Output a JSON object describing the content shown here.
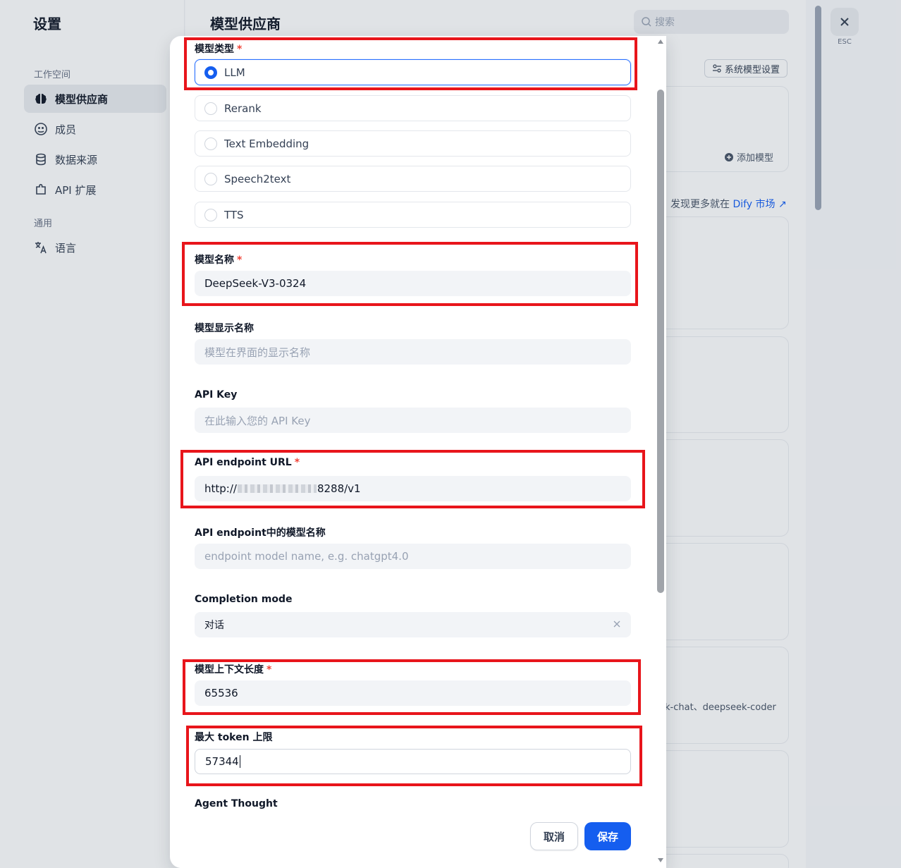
{
  "sidebar": {
    "title": "设置",
    "section_workspace": "工作空间",
    "section_general": "通用",
    "items": [
      {
        "label": "模型供应商",
        "icon": "brain-icon",
        "active": true
      },
      {
        "label": "成员",
        "icon": "members-icon",
        "active": false
      },
      {
        "label": "数据来源",
        "icon": "database-icon",
        "active": false
      },
      {
        "label": "API 扩展",
        "icon": "puzzle-icon",
        "active": false
      },
      {
        "label": "语言",
        "icon": "translate-icon",
        "active": false
      }
    ]
  },
  "main": {
    "title": "模型供应商",
    "search_placeholder": "搜索",
    "system_model_settings": "系统模型设置",
    "add_model": "添加模型",
    "discover_prefix": "发现更多就在",
    "discover_link": "Dify 市场",
    "provider_desc_fragment": "k-chat、deepseek-coder",
    "esc": "ESC"
  },
  "modal": {
    "model_type": {
      "label": "模型类型",
      "required": "*",
      "options": [
        "LLM",
        "Rerank",
        "Text Embedding",
        "Speech2text",
        "TTS"
      ],
      "selected": "LLM"
    },
    "model_name": {
      "label": "模型名称",
      "required": "*",
      "value": "DeepSeek-V3-0324"
    },
    "display_name": {
      "label": "模型显示名称",
      "placeholder": "模型在界面的显示名称"
    },
    "api_key": {
      "label": "API Key",
      "placeholder": "在此输入您的 API Key"
    },
    "endpoint_url": {
      "label": "API endpoint URL",
      "required": "*",
      "value_prefix": "http://",
      "value_suffix": "8288/v1"
    },
    "endpoint_model": {
      "label": "API endpoint中的模型名称",
      "placeholder": "endpoint model name, e.g. chatgpt4.0"
    },
    "completion_mode": {
      "label": "Completion mode",
      "value": "对话"
    },
    "context_length": {
      "label": "模型上下文长度",
      "required": "*",
      "value": "65536"
    },
    "max_tokens": {
      "label": "最大 token 上限",
      "value": "57344"
    },
    "agent_thought": {
      "label": "Agent Thought"
    },
    "cancel": "取消",
    "save": "保存"
  },
  "colors": {
    "primary": "#155eef",
    "required": "#f04438",
    "highlight": "#e8151b"
  }
}
